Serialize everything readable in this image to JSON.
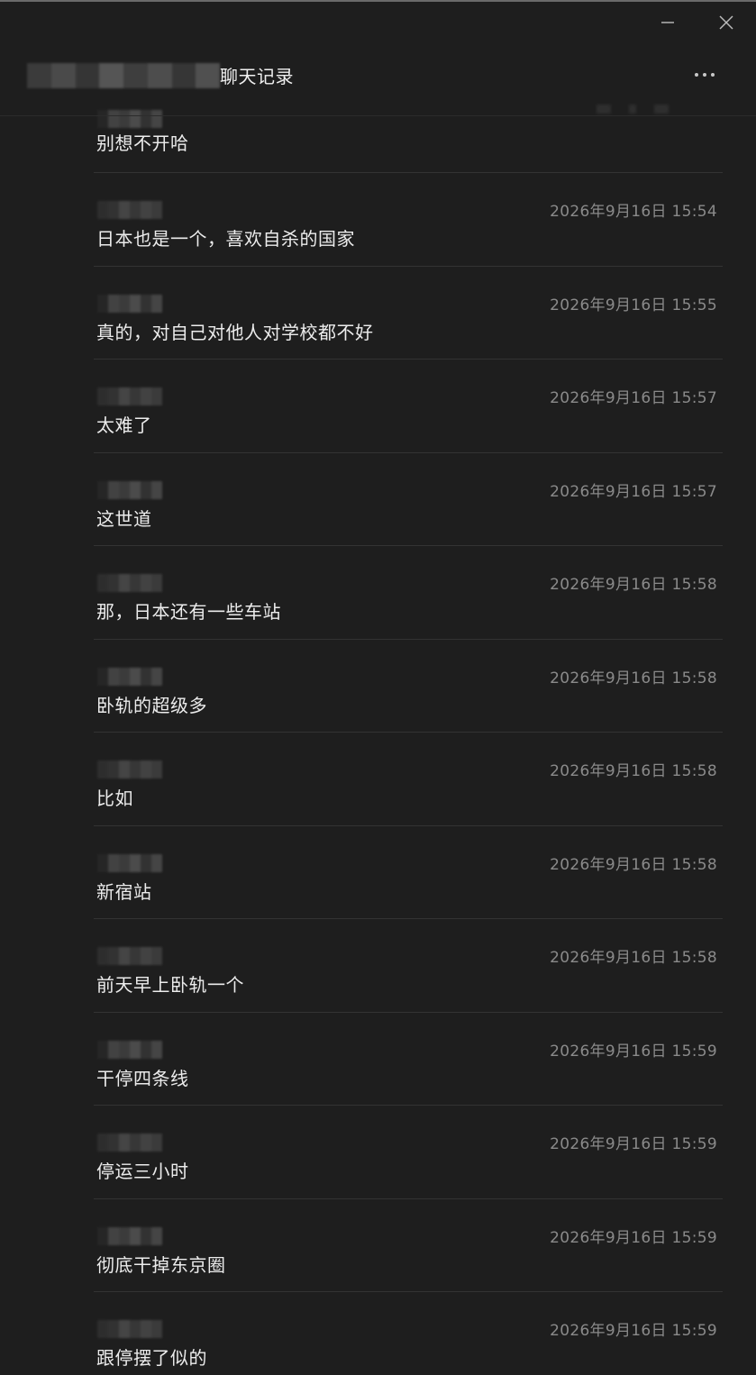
{
  "window": {
    "minimize_icon": "minimize-icon",
    "close_icon": "close-icon"
  },
  "header": {
    "title": "聊天记录",
    "more_icon": "more-horizontal-icon"
  },
  "colors": {
    "background": "#1e1e1e",
    "divider": "#333333",
    "text": "#ececec",
    "timestamp": "#8a8a8a"
  },
  "messages": [
    {
      "time": "",
      "text": "别想不开哈"
    },
    {
      "time": "2026年9月16日 15:54",
      "text": "日本也是一个，喜欢自杀的国家"
    },
    {
      "time": "2026年9月16日 15:55",
      "text": "真的，对自己对他人对学校都不好"
    },
    {
      "time": "2026年9月16日 15:57",
      "text": "太难了"
    },
    {
      "time": "2026年9月16日 15:57",
      "text": "这世道"
    },
    {
      "time": "2026年9月16日 15:58",
      "text": "那，日本还有一些车站"
    },
    {
      "time": "2026年9月16日 15:58",
      "text": "卧轨的超级多"
    },
    {
      "time": "2026年9月16日 15:58",
      "text": "比如"
    },
    {
      "time": "2026年9月16日 15:58",
      "text": "新宿站"
    },
    {
      "time": "2026年9月16日 15:58",
      "text": "前天早上卧轨一个"
    },
    {
      "time": "2026年9月16日 15:59",
      "text": "干停四条线"
    },
    {
      "time": "2026年9月16日 15:59",
      "text": "停运三小时"
    },
    {
      "time": "2026年9月16日 15:59",
      "text": "彻底干掉东京圈"
    },
    {
      "time": "2026年9月16日 15:59",
      "text": "跟停摆了似的"
    }
  ]
}
